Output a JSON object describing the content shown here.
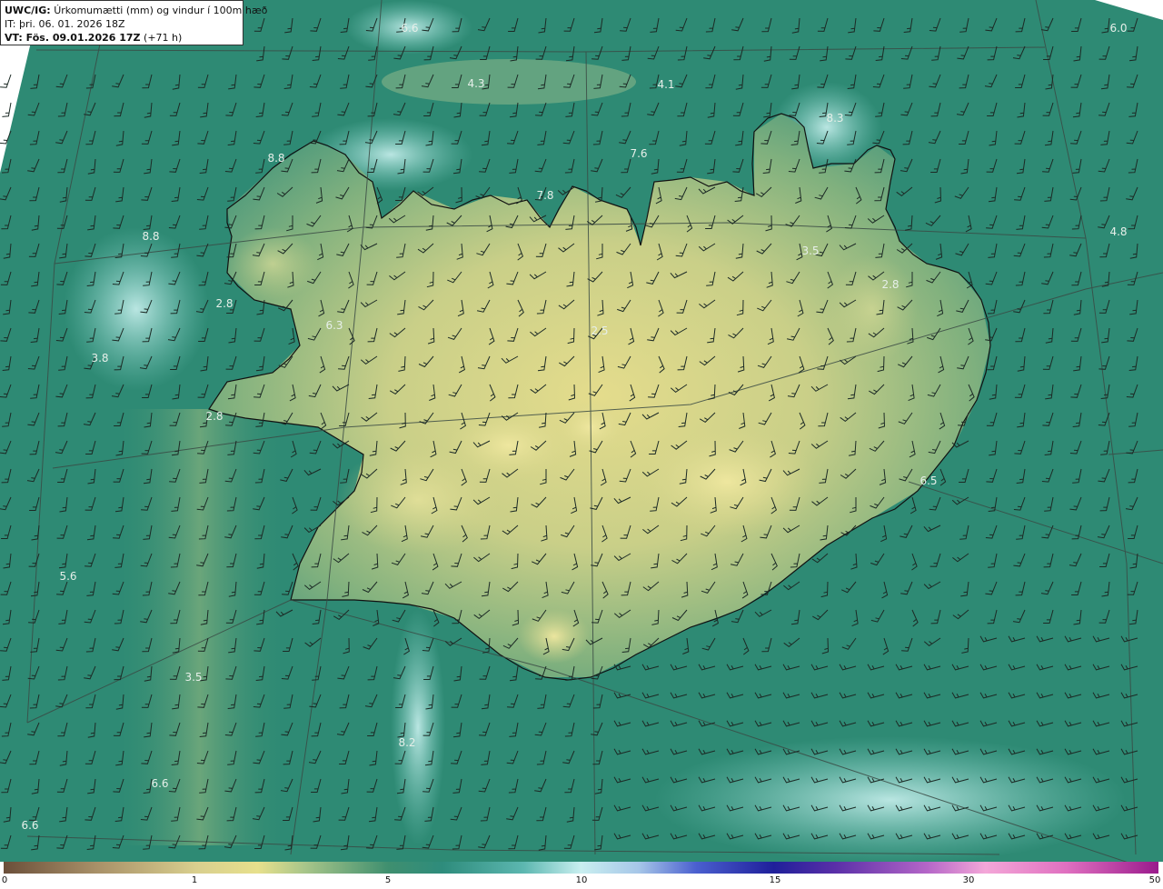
{
  "header": {
    "model": "UWC/IG:",
    "title": "Úrkomumætti (mm) og vindur í 100m hæð",
    "init_time": "IT: þri. 06. 01. 2026 18Z",
    "valid_prefix": "VT: Fös. 09.01.2026 17Z",
    "valid_suffix": "(+71 h)"
  },
  "value_labels": [
    "6.6",
    "6.0",
    "4.3",
    "4.1",
    "8.3",
    "7.6",
    "8.8",
    "7.8",
    "4.8",
    "8.8",
    "3.5",
    "2.8",
    "2.8",
    "6.3",
    "3.8",
    "2.5",
    "2.8",
    "6.5",
    "5.6",
    "3.5",
    "6.6",
    "6.6",
    "8.2"
  ],
  "colorbar": {
    "ticks": [
      "0",
      "1",
      "5",
      "10",
      "15",
      "30",
      "50"
    ],
    "colors": {
      "low": "#6b4f3a",
      "one": "#e7e08c",
      "five": "#3f8f6f",
      "ten": "#c9eff0",
      "fifteen": "#1f1f9a",
      "thirty": "#f4a7d8",
      "fifty": "#9a1a8c"
    }
  },
  "map_colors": {
    "ocean": "#2e8a74",
    "land_low": "#d9d98a",
    "land_mid": "#7fb07f",
    "coast": "#111111",
    "barb": "#1a2a24",
    "grid": "#3a4a44"
  }
}
